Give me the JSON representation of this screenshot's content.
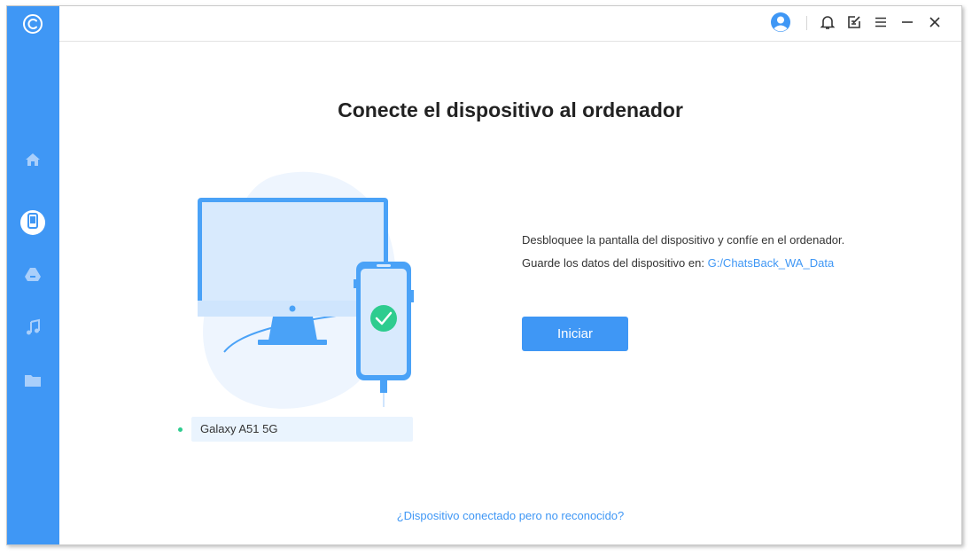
{
  "sidebar": {
    "logo": "chatsback-logo",
    "items": [
      {
        "icon": "home-icon",
        "active": false
      },
      {
        "icon": "phone-icon",
        "active": true
      },
      {
        "icon": "google-drive-icon",
        "active": false
      },
      {
        "icon": "music-note-icon",
        "active": false
      },
      {
        "icon": "folder-icon",
        "active": false
      }
    ]
  },
  "titlebar": {
    "icons": [
      "user-avatar-icon",
      "bell-icon",
      "feedback-edit-icon",
      "menu-icon",
      "minimize-icon",
      "close-icon"
    ]
  },
  "main": {
    "title": "Conecte el dispositivo al ordenador",
    "instruction": "Desbloquee la pantalla del dispositivo y confíe en el ordenador.",
    "save_label": "Guarde los datos del dispositivo en:",
    "save_path": "G:/ChatsBack_WA_Data",
    "start_button": "Iniciar",
    "help_link": "¿Dispositivo conectado pero no reconocido?"
  },
  "device": {
    "name": "Galaxy A51 5G",
    "status": "connected"
  },
  "colors": {
    "accent": "#3f97f5",
    "status_connected": "#2ecc8f",
    "card_bg": "#eaf4fe",
    "title_text": "#222222"
  }
}
